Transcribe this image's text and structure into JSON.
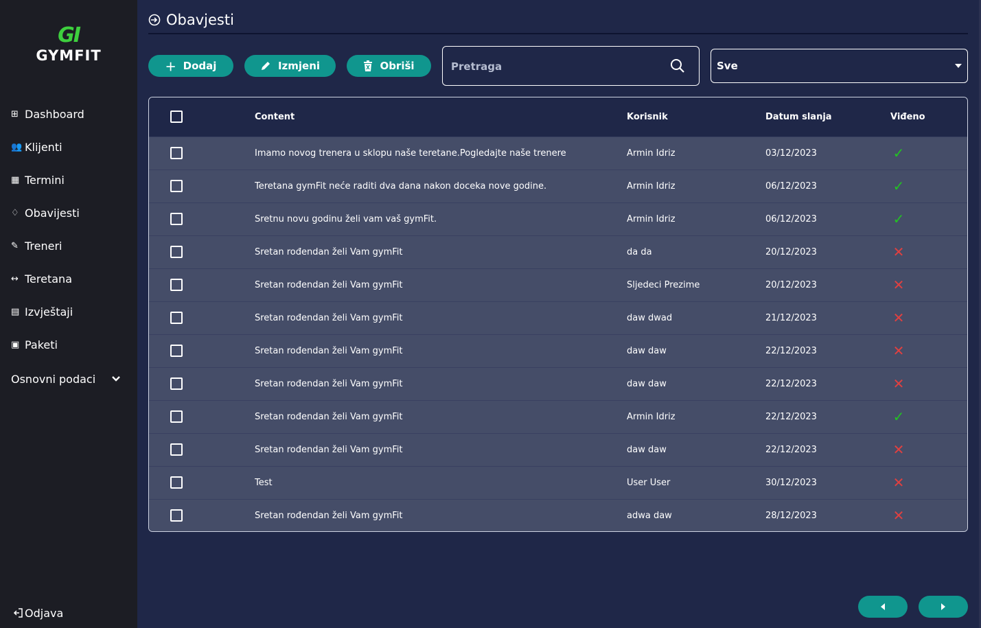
{
  "app": {
    "logo_mark": "GI",
    "logo_text": "GYMFIT"
  },
  "sidebar": {
    "items": [
      {
        "label": "Dashboard",
        "icon": "dashboard-icon",
        "glyph": "⊞"
      },
      {
        "label": "Klijenti",
        "icon": "users-icon",
        "glyph": "👥"
      },
      {
        "label": "Termini",
        "icon": "calendar-icon",
        "glyph": "▦"
      },
      {
        "label": "Obavijesti",
        "icon": "bell-icon",
        "glyph": "♢"
      },
      {
        "label": "Treneri",
        "icon": "trainer-icon",
        "glyph": "✎"
      },
      {
        "label": "Teretana",
        "icon": "dumbbell-icon",
        "glyph": "↔"
      },
      {
        "label": "Izvještaji",
        "icon": "report-icon",
        "glyph": "▤"
      },
      {
        "label": "Paketi",
        "icon": "package-icon",
        "glyph": "▣"
      }
    ],
    "expand_label": "Osnovni podaci",
    "logout_label": "Odjava"
  },
  "page": {
    "title": "Obavjesti"
  },
  "toolbar": {
    "add_label": "Dodaj",
    "edit_label": "Izmjeni",
    "delete_label": "Obriši",
    "search_placeholder": "Pretraga",
    "filter_value": "Sve"
  },
  "table": {
    "headers": {
      "content": "Content",
      "user": "Korisnik",
      "date": "Datum slanja",
      "seen": "Viđeno"
    },
    "rows": [
      {
        "content": "Imamo novog trenera u sklopu naše teretane.Pogledajte naše trenere",
        "user": "Armin Idriz",
        "date": "03/12/2023",
        "seen": true
      },
      {
        "content": "Teretana gymFit neće raditi dva dana nakon doceka nove godine.",
        "user": "Armin Idriz",
        "date": "06/12/2023",
        "seen": true
      },
      {
        "content": "Sretnu novu godinu želi vam vaš gymFit.",
        "user": "Armin Idriz",
        "date": "06/12/2023",
        "seen": true
      },
      {
        "content": "Sretan rođendan želi Vam gymFit",
        "user": "da da",
        "date": "20/12/2023",
        "seen": false
      },
      {
        "content": "Sretan rođendan želi Vam gymFit",
        "user": "Sljedeci Prezime",
        "date": "20/12/2023",
        "seen": false
      },
      {
        "content": "Sretan rođendan želi Vam gymFit",
        "user": "daw dwad",
        "date": "21/12/2023",
        "seen": false
      },
      {
        "content": "Sretan rođendan želi Vam gymFit",
        "user": "daw daw",
        "date": "22/12/2023",
        "seen": false
      },
      {
        "content": "Sretan rođendan želi Vam gymFit",
        "user": "daw daw",
        "date": "22/12/2023",
        "seen": false
      },
      {
        "content": "Sretan rođendan želi Vam gymFit",
        "user": "Armin Idriz",
        "date": "22/12/2023",
        "seen": true
      },
      {
        "content": "Sretan rođendan želi Vam gymFit",
        "user": "daw daw",
        "date": "22/12/2023",
        "seen": false
      },
      {
        "content": "Test",
        "user": "User User",
        "date": "30/12/2023",
        "seen": false
      },
      {
        "content": "Sretan rođendan želi Vam gymFit",
        "user": "adwa daw",
        "date": "28/12/2023",
        "seen": false
      }
    ]
  },
  "colors": {
    "sidebar_bg": "#1c1d24",
    "main_bg": "#1f2748",
    "row_bg": "#454d68",
    "accent": "#10968e",
    "logo_green": "#3ecf3e",
    "check_green": "#22c322",
    "cross_red": "#e04040"
  }
}
